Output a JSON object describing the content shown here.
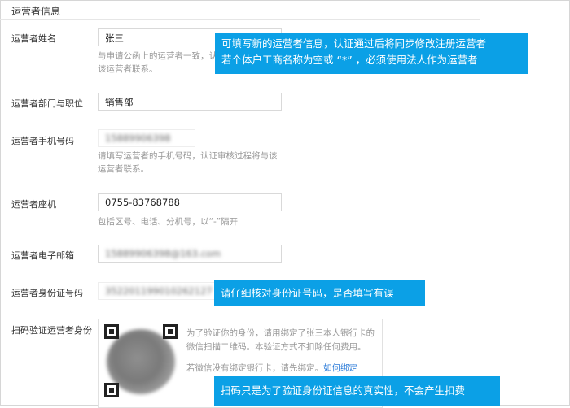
{
  "section": {
    "title": "运营者信息"
  },
  "fields": {
    "name": {
      "label": "运营者姓名",
      "value": "张三",
      "hint_lines": [
        "与申请公函上的运营者一致，认",
        "该运营者联系。"
      ]
    },
    "dept": {
      "label": "运营者部门与职位",
      "value": "销售部"
    },
    "phone": {
      "label": "运营者手机号码",
      "value": "15889906398",
      "hint_lines": [
        "请填写运营者的手机号码，认证审核过程将与该",
        "运营者联系。"
      ]
    },
    "landline": {
      "label": "运营者座机",
      "value": "0755-83768788",
      "hint": "包括区号、电话、分机号，以“-”隔开"
    },
    "email": {
      "label": "运营者电子邮箱",
      "value": "15889906398@163.com"
    },
    "idcard": {
      "label": "运营者身份证号码",
      "value": "352201199010262127"
    },
    "scan": {
      "label": "扫码验证运营者身份",
      "text_lines": [
        "为了验证你的身份，请用绑定了张三本人银行卡的",
        "微信扫描二维码。本验证方式不扣除任何费用。"
      ],
      "bind_text": "若微信没有绑定银行卡，请先绑定。",
      "bind_link": "如何绑定"
    }
  },
  "callouts": {
    "top_lines": [
      "可填写新的运营者信息，认证通过后将同步修改注册运营者",
      "若个体户工商名称为空或 “*” ，必须使用法人作为运营者"
    ],
    "idcard": "请仔细核对身份证号码，是否填写有误",
    "scan": "扫码只是为了验证身份证信息的真实性，不会产生扣费"
  },
  "colors": {
    "callout_bg": "#0ba0e6",
    "link": "#2b7bd8"
  }
}
